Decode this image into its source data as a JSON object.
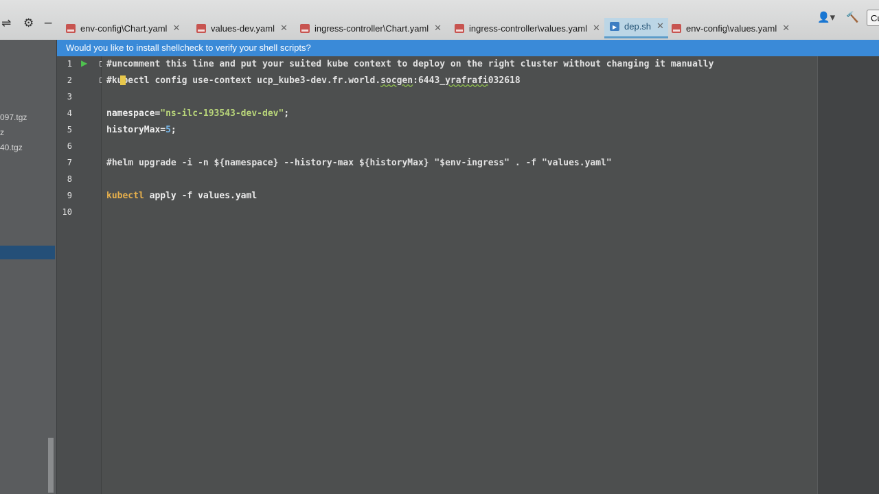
{
  "toolbar": {
    "icons": [
      "sliders-icon",
      "gear-icon",
      "minimize-icon"
    ]
  },
  "tabs": [
    {
      "label": "env-config\\Chart.yaml",
      "type": "yaml",
      "active": false
    },
    {
      "label": "values-dev.yaml",
      "type": "yaml",
      "active": false
    },
    {
      "label": "ingress-controller\\Chart.yaml",
      "type": "yaml",
      "active": false
    },
    {
      "label": "ingress-controller\\values.yaml",
      "type": "yaml",
      "active": false
    },
    {
      "label": "dep.sh",
      "type": "shell",
      "active": true
    },
    {
      "label": "env-config\\values.yaml",
      "type": "yaml",
      "active": false
    }
  ],
  "right_toolbar": {
    "button_label": "Cu"
  },
  "banner": {
    "text": "Would you like to install shellcheck to verify your shell scripts?"
  },
  "project": {
    "items": [
      "097.tgz",
      "z",
      "40.tgz"
    ]
  },
  "editor": {
    "line_numbers": [
      "1",
      "2",
      "3",
      "4",
      "5",
      "6",
      "7",
      "8",
      "9",
      "10"
    ],
    "lines": {
      "l1": "#uncomment this line and put your suited kube context to deploy on the right cluster without changing it manually",
      "l2_prefix": "#",
      "l2_a": "kubectl config use-context ucp_kube3-dev.fr.world.",
      "l2_b": "socgen",
      "l2_c": ":6443_",
      "l2_d": "yrafrafi",
      "l2_e": "032618",
      "l4_a": "namespace=",
      "l4_b": "\"ns-ilc-193543-dev-dev\"",
      "l4_c": ";",
      "l5_a": "historyMax=",
      "l5_b": "5",
      "l5_c": ";",
      "l7": "#helm upgrade -i -n ${namespace} --history-max ${historyMax} \"$env-ingress\" . -f \"values.yaml\"",
      "l9_a": "kubectl",
      "l9_b": " apply -f values.yaml"
    }
  },
  "colors": {
    "banner": "#3a8ad8",
    "active_tab": "#bcd6e6",
    "string": "#b9d67a",
    "number": "#76b6e8",
    "command": "#e7b04c"
  }
}
